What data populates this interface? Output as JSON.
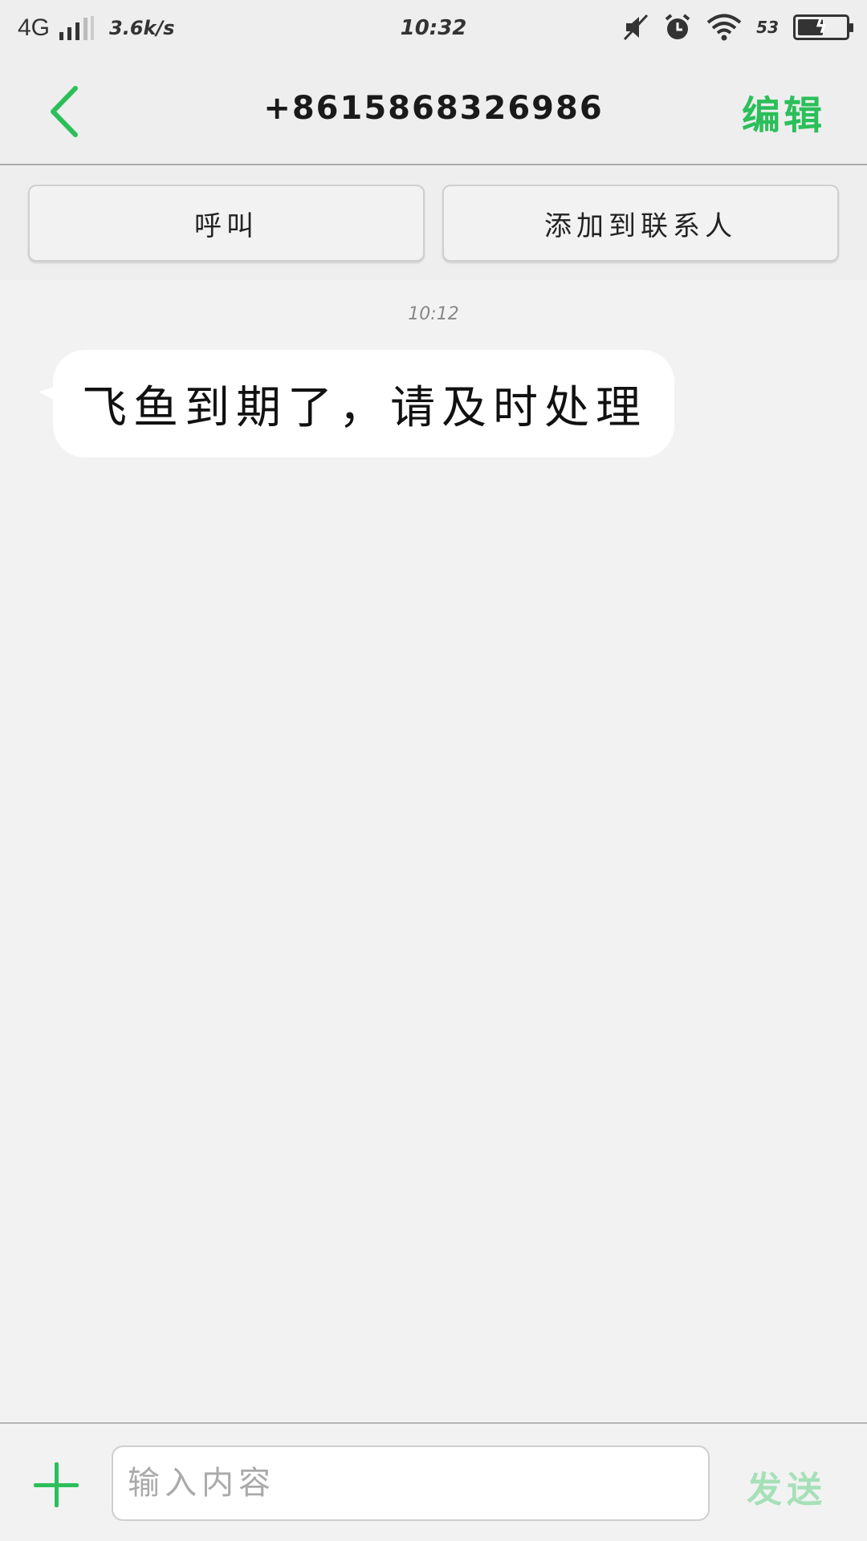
{
  "status_bar": {
    "network": "4G",
    "speed": "3.6k/s",
    "time": "10:32",
    "battery_percent": "53",
    "battery_level": 0.53,
    "icons": [
      "signal-bars-icon",
      "mute-icon",
      "alarm-icon",
      "wifi-icon",
      "battery-icon"
    ]
  },
  "header": {
    "back_icon": "chevron-left-icon",
    "contact_number": "+8615868326986",
    "edit_label": "编辑"
  },
  "actions": {
    "call_label": "呼叫",
    "add_contact_label": "添加到联系人"
  },
  "conversation": {
    "messages": [
      {
        "time": "10:12",
        "text": "飞鱼到期了，请及时处理",
        "direction": "incoming"
      }
    ]
  },
  "composer": {
    "add_icon": "plus-icon",
    "input_placeholder": "输入内容",
    "input_value": "",
    "send_label": "发送"
  },
  "colors": {
    "accent": "#2bbf5a",
    "send_disabled": "#a6e0b8",
    "background": "#f2f2f2",
    "bar_background": "#eeeeee"
  }
}
